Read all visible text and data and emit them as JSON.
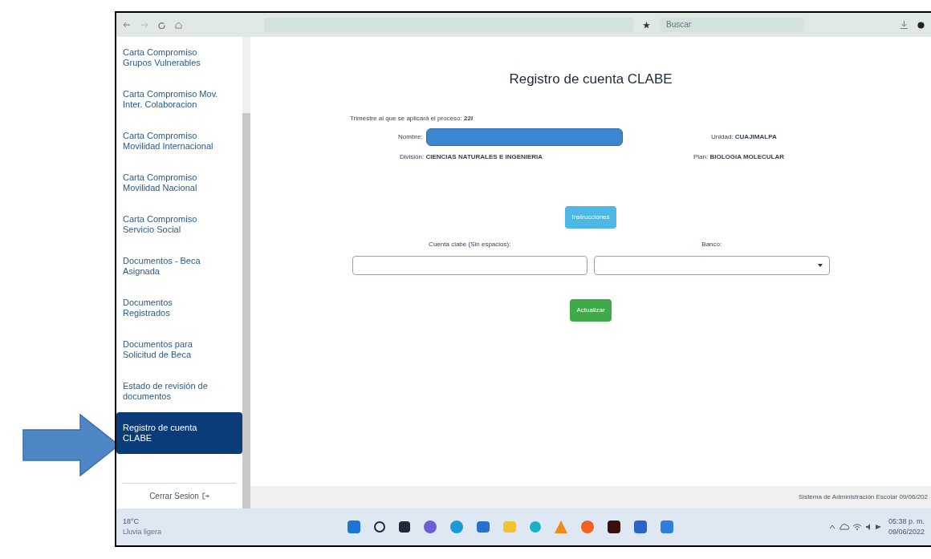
{
  "browser": {
    "search_placeholder": "Buscar"
  },
  "sidebar": {
    "items": [
      {
        "label": "Carta Compromiso Grupos Vulnerables",
        "selected": false
      },
      {
        "label": "Carta Compromiso Mov. Inter. Colaboracion",
        "selected": false
      },
      {
        "label": "Carta Compromiso Movilidad Internacional",
        "selected": false
      },
      {
        "label": "Carta Compromiso Movilidad Nacional",
        "selected": false
      },
      {
        "label": "Carta Compromiso Servicio Social",
        "selected": false
      },
      {
        "label": "Documentos - Beca Asignada",
        "selected": false
      },
      {
        "label": "Documentos Registrados",
        "selected": false
      },
      {
        "label": "Documentos para Solicitud de Beca",
        "selected": false
      },
      {
        "label": "Estado de revisión de documentos",
        "selected": false
      },
      {
        "label": "Registro de cuenta CLABE",
        "selected": true
      }
    ],
    "logout": "Cerrar Sesion"
  },
  "form": {
    "title": "Registro de cuenta CLABE",
    "term_label": "Trimestre al que se aplicará el proceso:",
    "term_value": "22I",
    "name_label": "Nombre:",
    "unit_label": "Unidad:",
    "unit_value": "CUAJIMALPA",
    "division_label": "División:",
    "division_value": "CIENCIAS NATURALES E INGENIERIA",
    "plan_label": "Plan:",
    "plan_value": "BIOLOGIA MOLECULAR",
    "instructions_button": "Instrucciones",
    "clabe_label": "Cuenta clabe (Sin espacios):",
    "bank_label": "Banco:",
    "update_button": "Actualizar"
  },
  "footer": "Sistema de Administración Escolar 09/06/202",
  "taskbar": {
    "weather_temp": "18°C",
    "weather_text": "Lluvia ligera",
    "time": "05:38 p. m.",
    "date": "09/06/2022"
  }
}
